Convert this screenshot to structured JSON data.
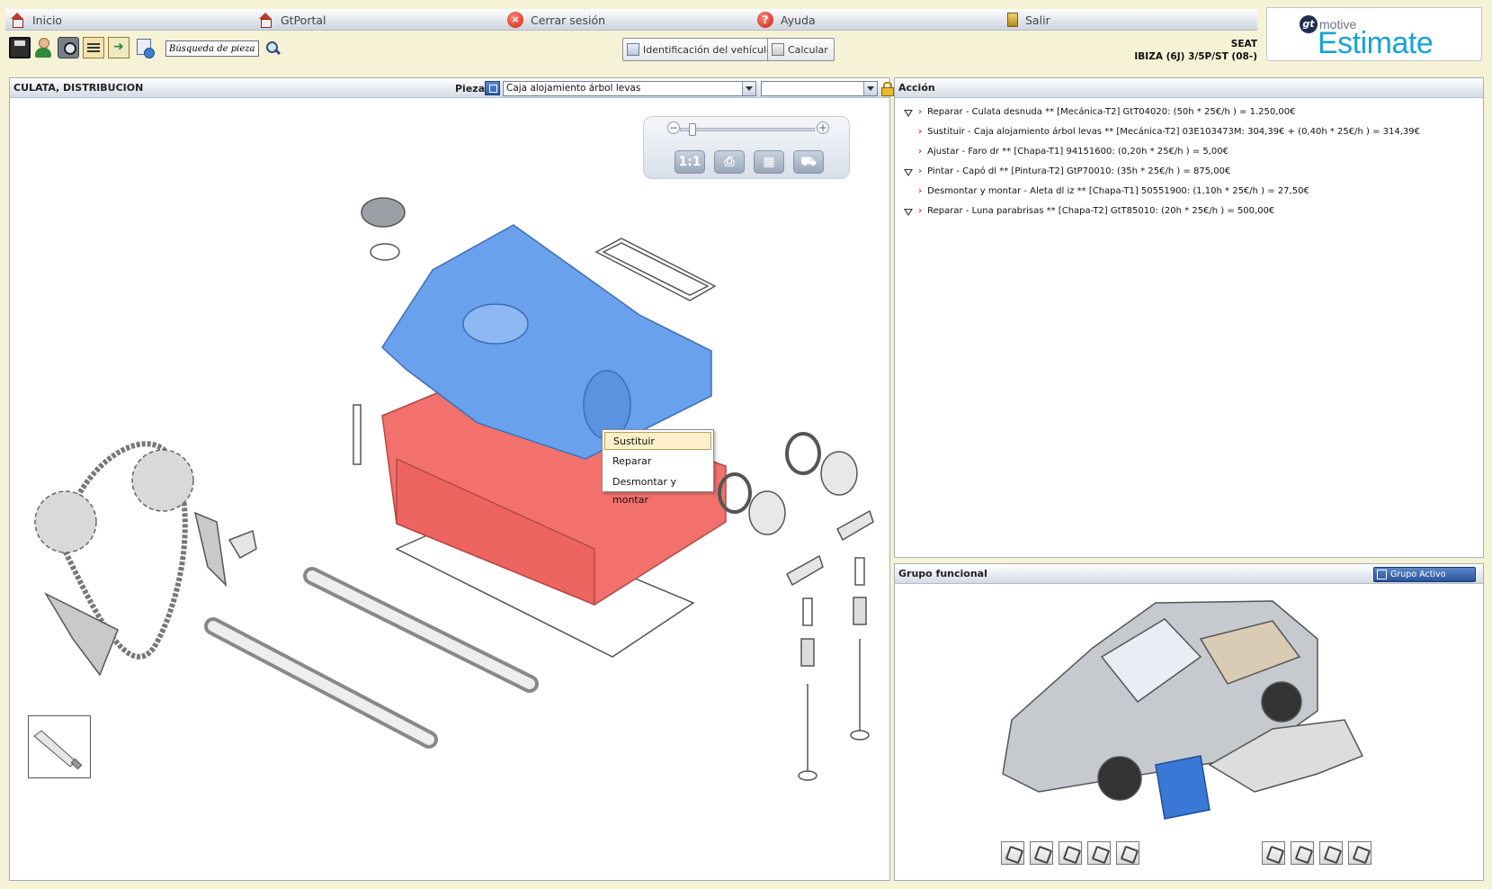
{
  "menu": {
    "items": [
      {
        "label": "Inicio",
        "icon": "home-icon"
      },
      {
        "label": "GtPortal",
        "icon": "home-icon"
      },
      {
        "label": "Cerrar sesión",
        "icon": "close-icon"
      },
      {
        "label": "Ayuda",
        "icon": "help-icon"
      },
      {
        "label": "Salir",
        "icon": "exit-door-icon"
      }
    ]
  },
  "toolbar": {
    "search_value": "Búsqueda de piezas",
    "identify_vehicle_label": "Identificación del vehículo",
    "calculate_label": "Calcular"
  },
  "vehicle": {
    "make": "SEAT",
    "model": "IBIZA (6J) 3/5P/ST (08-)"
  },
  "logo": {
    "gt": "gt",
    "motive": "motive",
    "estimate": "Estimate",
    "color": "#17a2d8"
  },
  "diagram_panel": {
    "title": "CULATA, DISTRIBUCION",
    "part_label": "Pieza",
    "part_selected": "Caja alojamiento árbol levas",
    "part_selected2": "",
    "zoom_fit_label": "1:1",
    "highlight_selected_color": "#6aa1ec",
    "highlight_action_color": "#f2716c"
  },
  "context_menu": {
    "items": [
      "Sustituir",
      "Reparar",
      "Desmontar y montar"
    ]
  },
  "action_panel": {
    "title": "Acción",
    "rows": [
      "Reparar - Culata desnuda ** [Mecánica-T2] GtT04020: (50h * 25€/h ) = 1.250,00€",
      "Sustituir - Caja alojamiento árbol levas ** [Mecánica-T2] 03E103473M: 304,39€ + (0,40h * 25€/h ) = 314,39€",
      "Ajustar - Faro dr ** [Chapa-T1] 94151600: (0,20h * 25€/h ) = 5,00€",
      "Pintar - Capó dl ** [Pintura-T2] GtP70010: (35h * 25€/h ) = 875,00€",
      "Desmontar y montar - Aleta dl iz ** [Chapa-T1] 50551900: (1,10h * 25€/h ) = 27,50€",
      "Reparar - Luna parabrisas ** [Chapa-T2] GtT85010: (20h * 25€/h ) = 500,00€"
    ]
  },
  "group_panel": {
    "title": "Grupo funcional",
    "active_button": "Grupo Activo"
  }
}
